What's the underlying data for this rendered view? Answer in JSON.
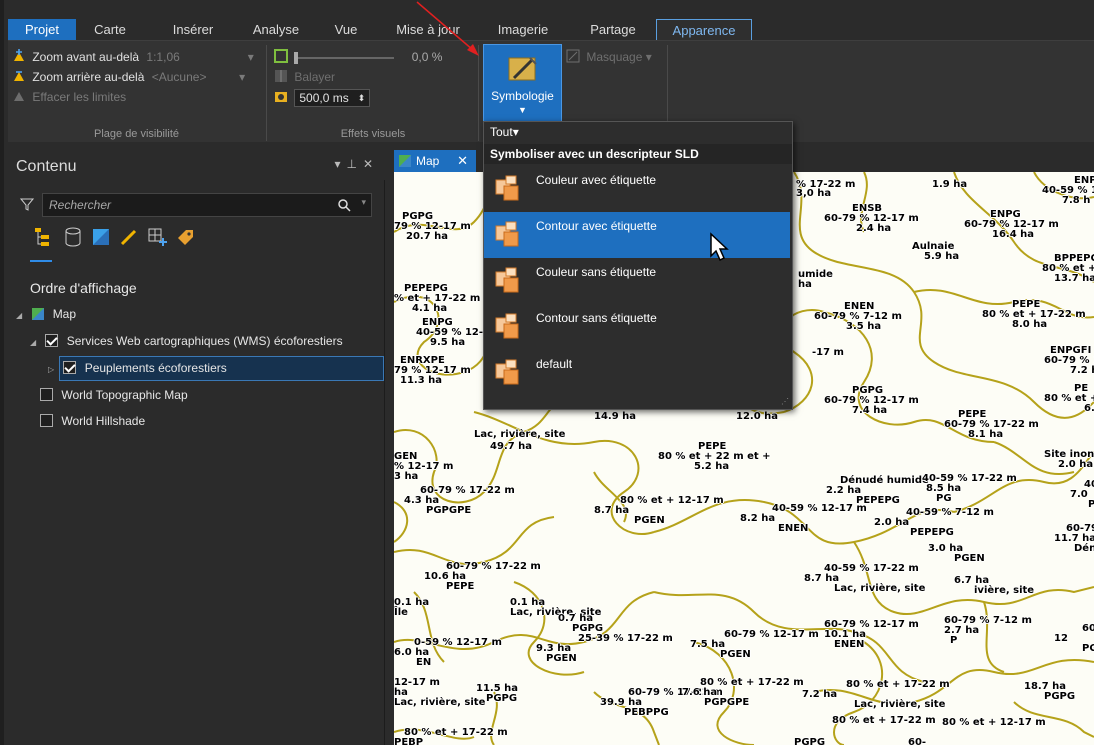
{
  "ribbon_tabs": [
    "Projet",
    "Carte",
    "Insérer",
    "Analyse",
    "Vue",
    "Mise à jour",
    "Imagerie",
    "Partage",
    "Apparence"
  ],
  "active_tab": "Apparence",
  "visibility_range": {
    "zoom_in_label": "Zoom avant au-delà",
    "zoom_in_value": "1:1,06",
    "zoom_out_label": "Zoom arrière au-delà",
    "zoom_out_value": "<Aucune>",
    "clear_label": "Effacer les limites",
    "group_label": "Plage de visibilité"
  },
  "effects": {
    "transparency_value": "0,0 %",
    "swipe_label": "Balayer",
    "flicker_value": "500,0 ms",
    "group_label": "Effets visuels"
  },
  "symbology_button": "Symbologie",
  "masking_label": "Masquage",
  "contents": {
    "title": "Contenu",
    "search_placeholder": "Rechercher",
    "draw_order_label": "Ordre d'affichage",
    "layers": [
      {
        "label": "Map"
      },
      {
        "label": "Services Web cartographiques (WMS) écoforestiers"
      },
      {
        "label": "Peuplements écoforestiers"
      },
      {
        "label": "World Topographic Map"
      },
      {
        "label": "World Hillshade"
      }
    ]
  },
  "map_tab": {
    "label": "Map"
  },
  "dropdown": {
    "filter_label": "Tout",
    "header": "Symboliser avec un descripteur SLD",
    "items": [
      "Couleur avec étiquette",
      "Contour avec étiquette",
      "Couleur sans étiquette",
      "Contour sans étiquette",
      "default"
    ],
    "selected_index": 1
  },
  "map_labels": [
    "% 17-22 m",
    "3,0 ha",
    "1.9 ha",
    "ENP",
    "40-59 % 1",
    "7.8 h",
    "PGPG",
    "79 % 12-17 m",
    "20.7 ha",
    "ENSB",
    "60-79 % 12-17 m",
    "2.4 ha",
    "ENPG",
    "60-79 % 12-17 m",
    "16.4 ha",
    "Aulnaie",
    "5.9 ha",
    "BPPEPG",
    "80 % et + 12-1",
    "13.7 ha",
    "umide",
    "ha",
    "PEPEPG",
    "% et + 17-22 m",
    "4.1 ha",
    "ENPG",
    "40-59 % 12-17",
    "9.5 ha",
    "ENEN",
    "60-79 % 7-12 m",
    "3.5 ha",
    "PEPE",
    "80 % et + 17-22 m",
    "8.0 ha",
    "ENRXPE",
    "79 % 12-17 m",
    "11.3 ha",
    "-17 m",
    "ENPGFI",
    "60-79 % 12-17",
    "7.2 ha",
    "PGPG",
    "60-79 % 12-17 m",
    "7.4 ha",
    "PE",
    "80 % et +",
    "6.8",
    "14.9 ha",
    "12.0 ha",
    "PEPE",
    "60-79 % 17-22 m",
    "8.1 ha",
    "Lac, rivière, site",
    "49.7 ha",
    "Site inondé, exo",
    "2.0 ha",
    "GEN",
    "% 12-17 m",
    "3 ha",
    "PEPE",
    "80 % et + 22 m et +",
    "5.2 ha",
    "Dénudé humide",
    "2.2 ha",
    "PEPEPG",
    "40-59 % 17-22 m",
    "8.5 ha",
    "PG",
    "40-59 %",
    "7.0",
    "PEPE",
    "60-79 % 17-22 m",
    "4.3 ha",
    "PGPGPE",
    "80 % et + 12-17 m",
    "8.7 ha",
    "PGEN",
    "40-59 % 12-17 m",
    "8.2 ha",
    "ENEN",
    "40-59 % 7-12 m",
    "2.0 ha",
    "PEPEPG",
    "60-79 % 17-2",
    "11.7 ha",
    "Dénudé humide",
    "3.0 ha",
    "PGEN",
    "60-79 % 17-22 m",
    "10.6 ha",
    "PEPE",
    "40-59 % 17-22 m",
    "8.7 ha",
    "Lac, rivière, site",
    "6.7 ha",
    "ivière, site",
    "0.1 ha",
    "Île",
    "0.1 ha",
    "Lac, rivière, site",
    "0.7 ha",
    "PGPG",
    "25-39 % 17-22 m",
    "9.3 ha",
    "PGEN",
    "60-79 % 12-17 m",
    "7.5 ha",
    "PGEN",
    "60-79 % 12-17 m",
    "10.1 ha",
    "ENEN",
    "60-79 % 7-12 m",
    "2.7 ha",
    "P",
    "60-79 %",
    "12",
    "PGEN",
    "0-59 % 12-17 m",
    "6.0 ha",
    "EN",
    "12-17 m",
    "ha",
    "Lac, rivière, site",
    "11.5 ha",
    "PGPG",
    "60-79 % 17-22 m",
    "39.9 ha",
    "PEBPPG",
    "80 % et + 17-22 m",
    "7.6 ha",
    "PGPGPE",
    "80 % et + 17-22 m",
    "7.2 ha",
    "Lac, rivière, site",
    "18.7 ha",
    "PGPG",
    "80 % et + 17-22 m",
    "PEBP",
    "80 % et + 17-22 m",
    "PGPG",
    "80 % et + 12-17 m",
    "60-"
  ],
  "colors": {
    "accent": "#1e6fbf",
    "contour": "#b5a21a",
    "map_bg": "#fdfdf6"
  }
}
